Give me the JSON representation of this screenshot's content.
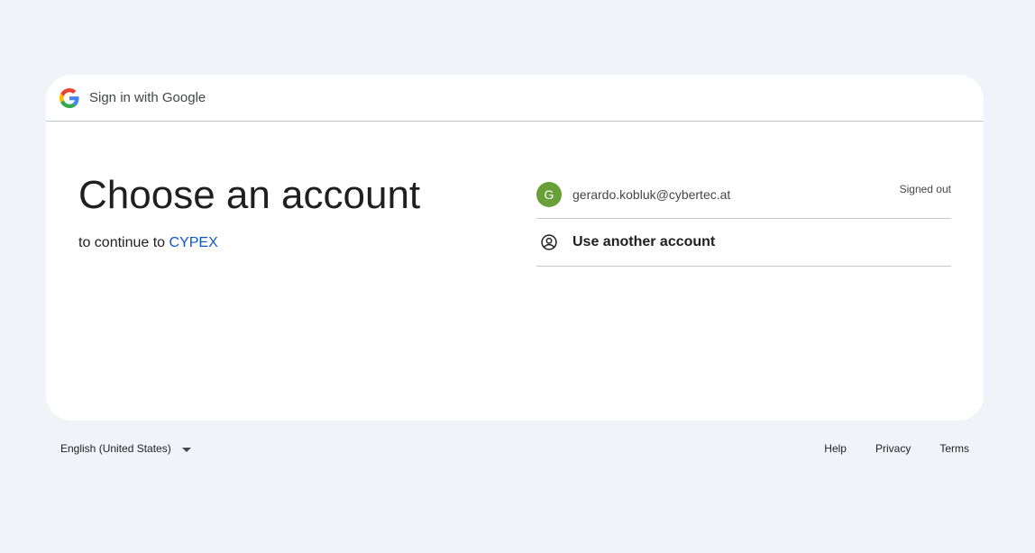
{
  "header": {
    "logo_icon": "google-g-icon",
    "title": "Sign in with Google"
  },
  "main": {
    "title": "Choose an account",
    "subtitle_prefix": "to continue to ",
    "app_name": "CYPEX"
  },
  "accounts": [
    {
      "avatar_letter": "G",
      "avatar_color": "#689f38",
      "email": "gerardo.kobluk@cybertec.at",
      "status": "Signed out"
    }
  ],
  "use_another": {
    "icon": "account-circle-icon",
    "label": "Use another account"
  },
  "footer": {
    "language": "English (United States)",
    "links": [
      "Help",
      "Privacy",
      "Terms"
    ]
  },
  "colors": {
    "background": "#f0f4f9",
    "card": "#ffffff",
    "link": "#0b57d0",
    "divider": "#c4c7c5"
  }
}
